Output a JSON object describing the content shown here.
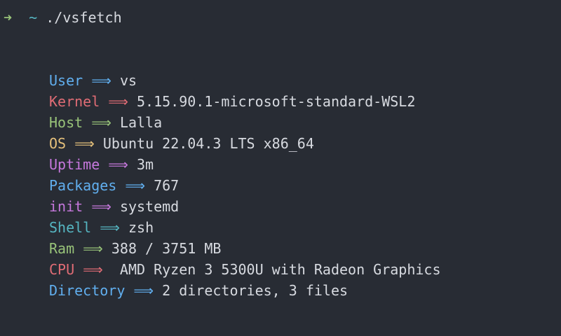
{
  "prompt": {
    "arrow": "➜",
    "tilde": "~",
    "command": "./vsfetch"
  },
  "colors": {
    "blue": "#61afef",
    "red": "#e06c75",
    "green": "#98c379",
    "yellow": "#e5c07b",
    "magenta": "#c678dd",
    "cyan": "#56b6c2",
    "text": "#d7dae0",
    "background": "#282c34"
  },
  "info": [
    {
      "key": "User",
      "sep": "⟹",
      "value": "vs",
      "color": "#61afef"
    },
    {
      "key": "Kernel",
      "sep": "⟹",
      "value": "5.15.90.1-microsoft-standard-WSL2",
      "color": "#e06c75"
    },
    {
      "key": "Host",
      "sep": "⟹",
      "value": "Lalla",
      "color": "#98c379"
    },
    {
      "key": "OS",
      "sep": "⟹",
      "value": "Ubuntu 22.04.3 LTS x86_64",
      "color": "#e5c07b"
    },
    {
      "key": "Uptime",
      "sep": "⟹",
      "value": "3m",
      "color": "#c678dd"
    },
    {
      "key": "Packages",
      "sep": "⟹",
      "value": "767",
      "color": "#61afef"
    },
    {
      "key": "init",
      "sep": "⟹",
      "value": "systemd",
      "color": "#c678dd"
    },
    {
      "key": "Shell",
      "sep": "⟹",
      "value": "zsh",
      "color": "#56b6c2"
    },
    {
      "key": "Ram",
      "sep": "⟹",
      "value": "388 / 3751 MB",
      "color": "#98c379"
    },
    {
      "key": "CPU",
      "sep": "⟹",
      "value": " AMD Ryzen 3 5300U with Radeon Graphics",
      "color": "#e06c75"
    },
    {
      "key": "Directory",
      "sep": "⟹",
      "value": "2 directories, 3 files",
      "color": "#61afef"
    }
  ]
}
